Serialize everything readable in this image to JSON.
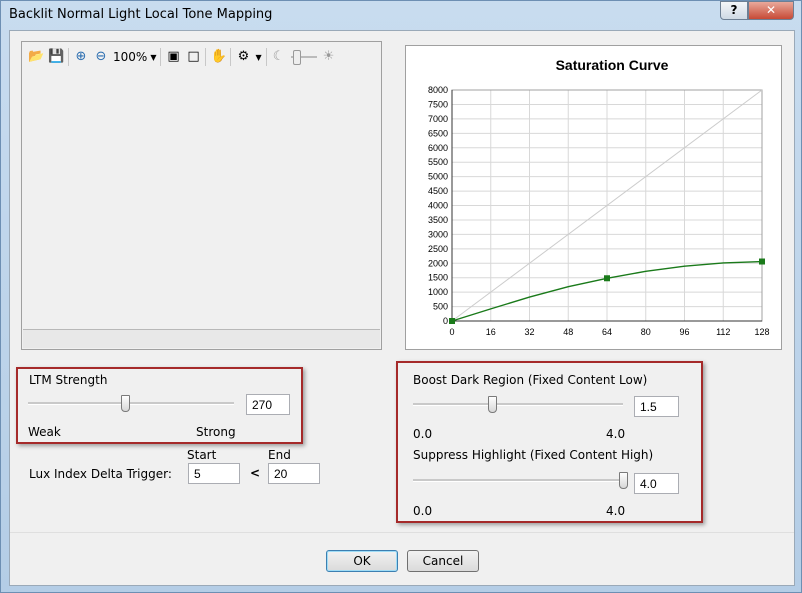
{
  "window": {
    "title": "Backlit Normal Light Local Tone Mapping",
    "help_label": "?",
    "close_label": "✕"
  },
  "toolbar": {
    "zoom_value": "100%",
    "icons": [
      "open-folder-icon",
      "save-icon",
      "zoom-in-icon",
      "zoom-out-icon",
      "fit-icon",
      "actual-size-icon",
      "hand-pan-icon",
      "settings-icon",
      "moon-icon",
      "sun-icon"
    ]
  },
  "chart_data": {
    "type": "line",
    "title": "Saturation Curve",
    "xlim": [
      0,
      128
    ],
    "ylim": [
      0,
      8000
    ],
    "x_ticks": [
      0,
      16,
      32,
      48,
      64,
      80,
      96,
      112,
      128
    ],
    "y_ticks": [
      0,
      500,
      1000,
      1500,
      2000,
      2500,
      3000,
      3500,
      4000,
      4500,
      5000,
      5500,
      6000,
      6500,
      7000,
      7500,
      8000
    ],
    "grid": true,
    "series": [
      {
        "style": "reference",
        "color": "#cccccc",
        "points": [
          [
            0,
            0
          ],
          [
            128,
            8000
          ]
        ]
      },
      {
        "style": "curve",
        "color": "#1a7a1a",
        "points": [
          [
            0,
            0
          ],
          [
            16,
            420
          ],
          [
            32,
            830
          ],
          [
            48,
            1190
          ],
          [
            64,
            1480
          ],
          [
            80,
            1720
          ],
          [
            96,
            1900
          ],
          [
            112,
            2010
          ],
          [
            128,
            2060
          ]
        ],
        "control_points": [
          [
            0,
            0
          ],
          [
            64,
            1480
          ],
          [
            128,
            2060
          ]
        ]
      }
    ]
  },
  "ltm": {
    "title": "LTM Strength",
    "value": "270",
    "weak_label": "Weak",
    "strong_label": "Strong",
    "level": 0.47
  },
  "lux": {
    "label": "Lux Index Delta Trigger:",
    "start_label": "Start",
    "end_label": "End",
    "start_value": "5",
    "lt": "<",
    "end_value": "20"
  },
  "boost": {
    "title": "Boost Dark Region (Fixed Content Low)",
    "value": "1.5",
    "min_label": "0.0",
    "max_label": "4.0",
    "level": 0.375
  },
  "suppress": {
    "title": "Suppress Highlight (Fixed Content High)",
    "value": "4.0",
    "min_label": "0.0",
    "max_label": "4.0",
    "level": 1.0
  },
  "buttons": {
    "ok": "OK",
    "cancel": "Cancel"
  }
}
